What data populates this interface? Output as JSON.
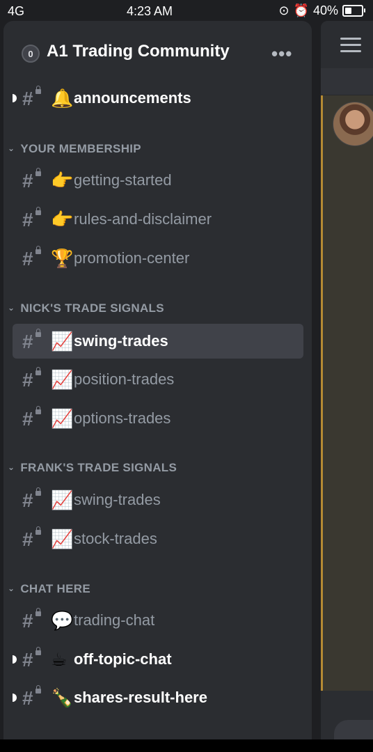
{
  "status_bar": {
    "network": "4G",
    "time": "4:23 AM",
    "battery": "40%",
    "battery_level": 0.4
  },
  "server": {
    "name": "A1 Trading Community",
    "icon_glyph": "0",
    "menu_glyph": "•••"
  },
  "top_channels": [
    {
      "emoji": "🔔",
      "name": "announcements",
      "unread": true
    }
  ],
  "categories": [
    {
      "title": "YOUR MEMBERSHIP",
      "channels": [
        {
          "emoji": "👉",
          "name": "getting-started"
        },
        {
          "emoji": "👉",
          "name": "rules-and-disclaimer"
        },
        {
          "emoji": "🏆",
          "name": "promotion-center"
        }
      ]
    },
    {
      "title": "NICK'S TRADE SIGNALS",
      "channels": [
        {
          "emoji": "📈",
          "name": "swing-trades",
          "selected": true
        },
        {
          "emoji": "📈",
          "name": "position-trades"
        },
        {
          "emoji": "📈",
          "name": "options-trades"
        }
      ]
    },
    {
      "title": "FRANK'S TRADE SIGNALS",
      "channels": [
        {
          "emoji": "📈",
          "name": "swing-trades"
        },
        {
          "emoji": "📈",
          "name": "stock-trades"
        }
      ]
    },
    {
      "title": "CHAT HERE",
      "channels": [
        {
          "emoji": "💬",
          "name": "trading-chat"
        },
        {
          "emoji": "☕",
          "name": "off-topic-chat",
          "unread": true
        },
        {
          "emoji": "🍾",
          "name": "shares-result-here",
          "unread": true
        }
      ]
    }
  ],
  "colors": {
    "sidebar_bg": "#2b2d31",
    "selected_bg": "#404249",
    "muted_text": "#949ba4",
    "highlight_line": "#b58a33"
  }
}
